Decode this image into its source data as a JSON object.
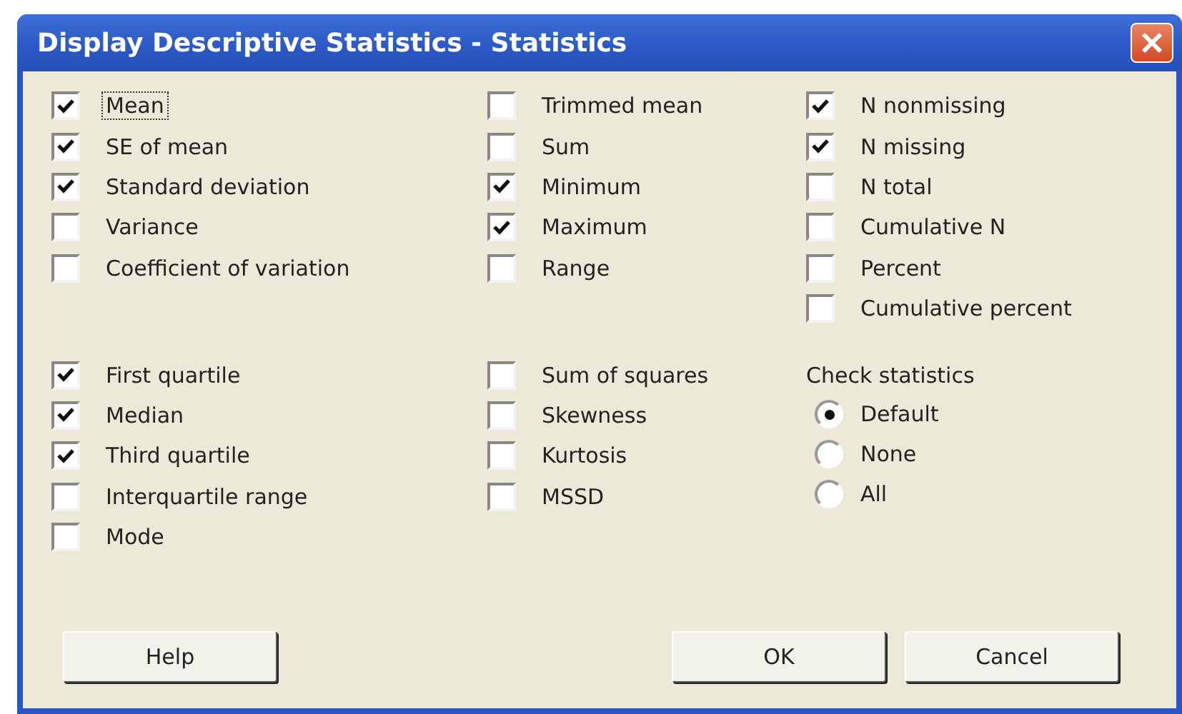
{
  "window": {
    "title": "Display Descriptive Statistics - Statistics"
  },
  "top_columns": [
    [
      {
        "label": "Mean",
        "checked": true,
        "focused": true
      },
      {
        "label": "SE of mean",
        "checked": true,
        "focused": false
      },
      {
        "label": "Standard deviation",
        "checked": true,
        "focused": false
      },
      {
        "label": "Variance",
        "checked": false,
        "focused": false
      },
      {
        "label": "Coefficient of variation",
        "checked": false,
        "focused": false
      }
    ],
    [
      {
        "label": "Trimmed mean",
        "checked": false,
        "focused": false
      },
      {
        "label": "Sum",
        "checked": false,
        "focused": false
      },
      {
        "label": "Minimum",
        "checked": true,
        "focused": false
      },
      {
        "label": "Maximum",
        "checked": true,
        "focused": false
      },
      {
        "label": "Range",
        "checked": false,
        "focused": false
      }
    ],
    [
      {
        "label": "N nonmissing",
        "checked": true,
        "focused": false
      },
      {
        "label": "N missing",
        "checked": true,
        "focused": false
      },
      {
        "label": "N total",
        "checked": false,
        "focused": false
      },
      {
        "label": "Cumulative N",
        "checked": false,
        "focused": false
      },
      {
        "label": "Percent",
        "checked": false,
        "focused": false
      },
      {
        "label": "Cumulative percent",
        "checked": false,
        "focused": false
      }
    ]
  ],
  "bottom_columns": [
    [
      {
        "label": "First quartile",
        "checked": true,
        "focused": false
      },
      {
        "label": "Median",
        "checked": true,
        "focused": false
      },
      {
        "label": "Third quartile",
        "checked": true,
        "focused": false
      },
      {
        "label": "Interquartile range",
        "checked": false,
        "focused": false
      },
      {
        "label": "Mode",
        "checked": false,
        "focused": false
      }
    ],
    [
      {
        "label": "Sum of squares",
        "checked": false,
        "focused": false
      },
      {
        "label": "Skewness",
        "checked": false,
        "focused": false
      },
      {
        "label": "Kurtosis",
        "checked": false,
        "focused": false
      },
      {
        "label": "MSSD",
        "checked": false,
        "focused": false
      }
    ]
  ],
  "check_statistics": {
    "label": "Check statistics",
    "options": [
      {
        "label": "Default",
        "selected": true
      },
      {
        "label": "None",
        "selected": false
      },
      {
        "label": "All",
        "selected": false
      }
    ]
  },
  "buttons": [
    {
      "label": "Help"
    },
    {
      "label": "OK"
    },
    {
      "label": "Cancel"
    }
  ]
}
